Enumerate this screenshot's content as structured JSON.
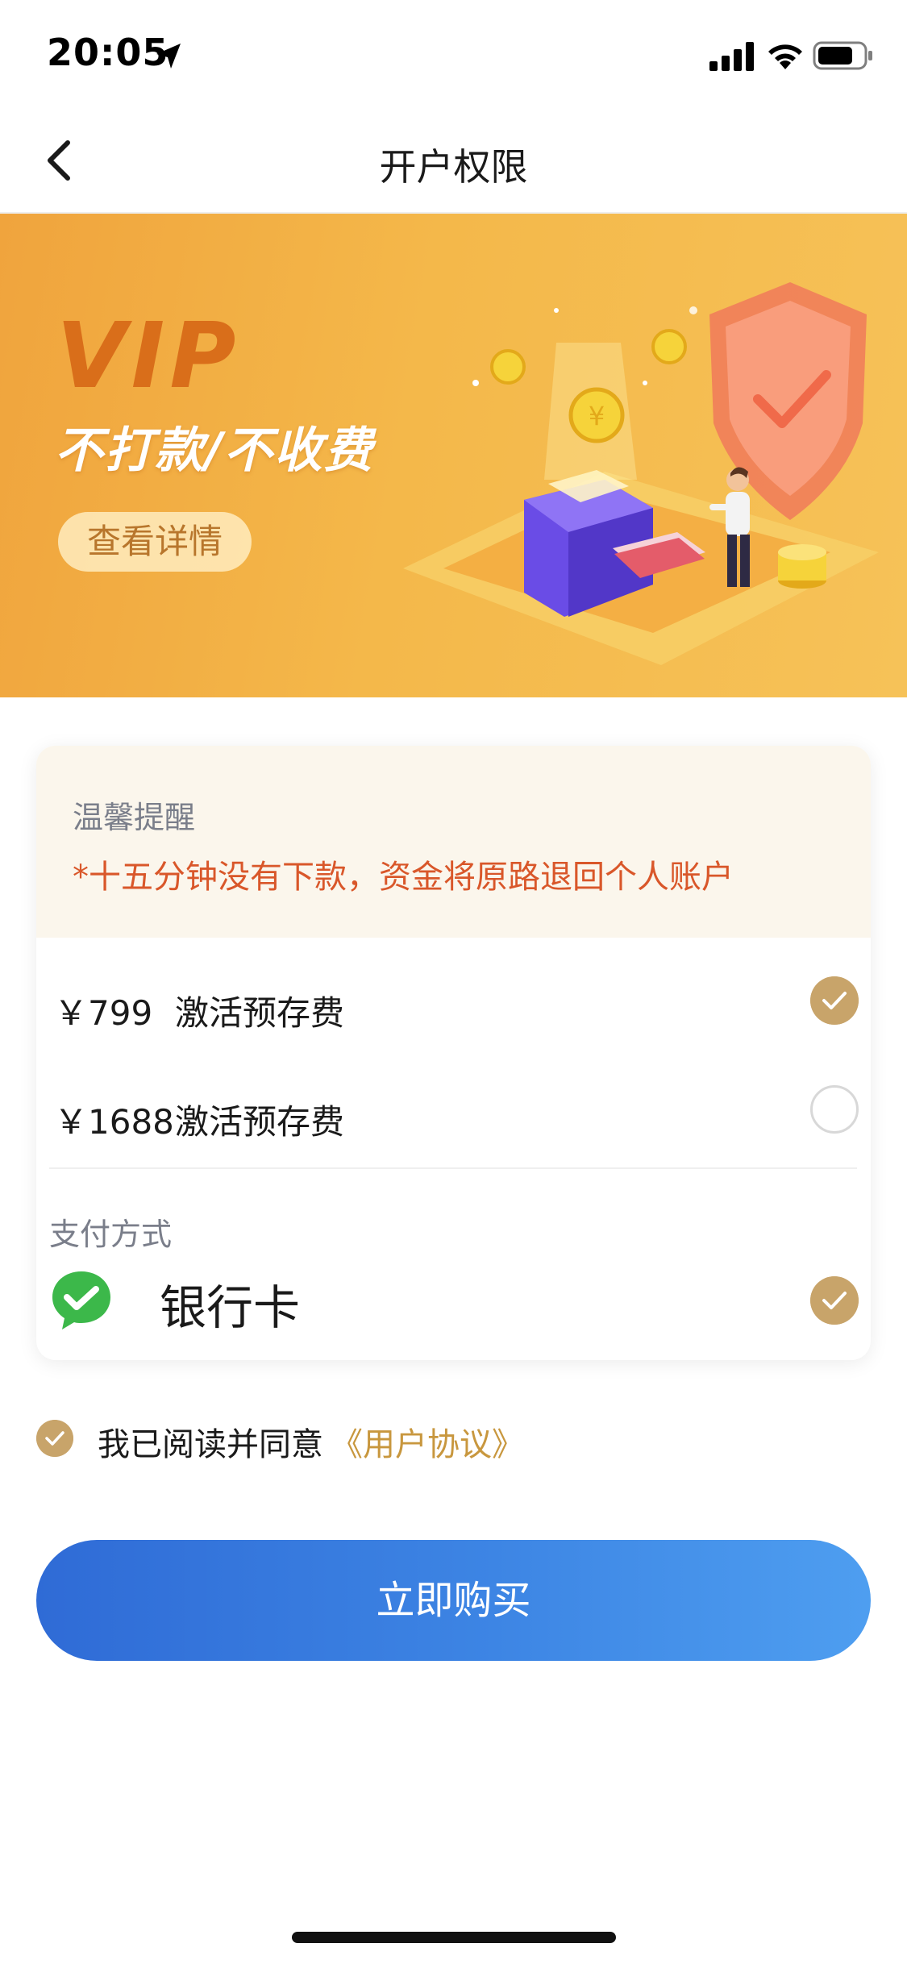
{
  "status_bar": {
    "time": "20:05",
    "icons": [
      "location-arrow-icon",
      "cellular-signal-icon",
      "wifi-icon",
      "battery-icon"
    ]
  },
  "nav": {
    "title": "开户权限",
    "back_icon": "chevron-left-icon"
  },
  "banner": {
    "headline": "VIP",
    "slogan": "不打款/不收费",
    "detail_button": "查看详情",
    "colors": {
      "background_start": "#f0a43d",
      "background_end": "#f6c258",
      "headline": "#d96e1a"
    }
  },
  "notice": {
    "title": "温馨提醒",
    "text": "*十五分钟没有下款，资金将原路退回个人账户",
    "text_color": "#d9572a"
  },
  "plans": [
    {
      "price": "￥799",
      "label": "激活预存费",
      "selected": true
    },
    {
      "price": "￥1688",
      "label": "激活预存费",
      "selected": false
    }
  ],
  "payment": {
    "section_title": "支付方式",
    "method_icon": "wechat-icon",
    "method_label": "银行卡",
    "selected": true
  },
  "agreement": {
    "checked": true,
    "text": "我已阅读并同意",
    "link": "《用户协议》",
    "link_color": "#c8973e"
  },
  "buy_button": {
    "label": "立即购买",
    "color_start": "#2f6bd6",
    "color_end": "#4e9ef0"
  },
  "accent_check_color": "#c8a46a"
}
